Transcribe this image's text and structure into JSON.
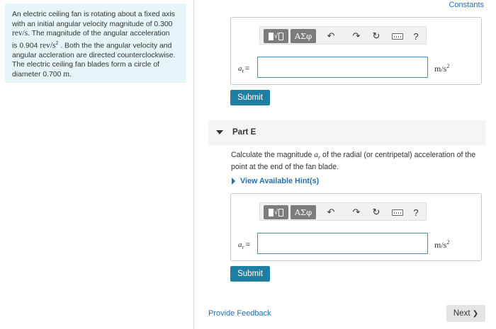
{
  "header": {
    "constants_link": "Constants"
  },
  "problem": {
    "lines": [
      "An electric ceiling fan is rotating about a fixed axis",
      "with an initial angular velocity magnitude of 0.300",
      "rev/s",
      ". The magnitude of the angular acceleration",
      "is 0.904",
      "rev/s",
      "2",
      ". Both the the angular velocity and",
      "angular accleration are directed counterclockwise.",
      "The electric ceiling fan blades form a circle of",
      "diameter 0.700",
      "m",
      "."
    ]
  },
  "toolbar": {
    "template_label": "√□",
    "greek_label": "ΑΣφ",
    "undo_icon": "↶",
    "redo_icon": "↷",
    "reset_icon": "↻",
    "keyboard_icon": "keyboard-icon",
    "help_label": "?"
  },
  "part_d": {
    "variable_symbol": "a",
    "variable_subscript": "t",
    "equals": "=",
    "input_value": "",
    "unit": "m/s",
    "unit_exp": "2",
    "submit_label": "Submit"
  },
  "part_e": {
    "title": "Part E",
    "question_prefix": "Calculate the magnitude",
    "question_symbol": "a",
    "question_symbol_sub": "r",
    "question_suffix": "of the radial (or centripetal) acceleration of the",
    "question_line2": "point at the end of the fan blade.",
    "hint_label": "View Available Hint(s)",
    "variable_symbol": "a",
    "variable_subscript": "r",
    "equals": "=",
    "input_value": "",
    "unit": "m/s",
    "unit_exp": "2",
    "submit_label": "Submit"
  },
  "footer": {
    "feedback_label": "Provide Feedback",
    "next_label": "Next",
    "next_icon": "❯"
  },
  "colors": {
    "accent": "#1f7fa3",
    "link": "#2a6ea8",
    "problem_bg": "#e6f5f8"
  }
}
